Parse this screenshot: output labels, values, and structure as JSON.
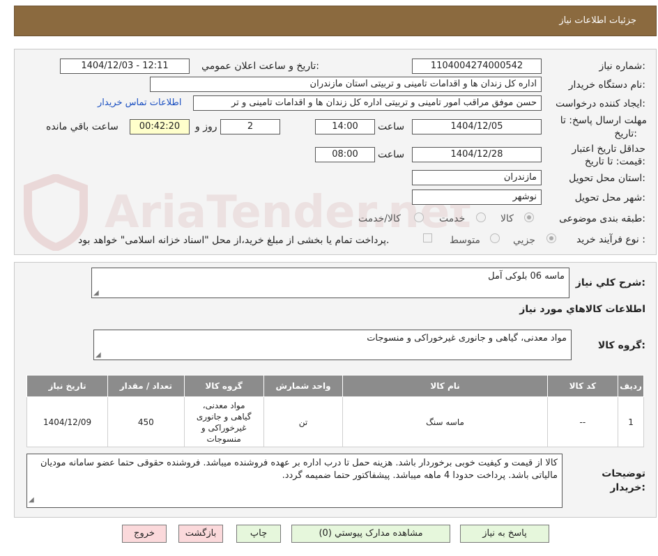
{
  "header": {
    "title": "جزئیات اطلاعات نیاز"
  },
  "watermark": "AriaTender.net",
  "form": {
    "need_number_label": "شماره نیاز:",
    "need_number": "1104004274000542",
    "announce_label": "تاریخ و ساعت اعلان عمومي:",
    "announce_value": "1404/12/03 - 12:11",
    "buyer_org_label": "نام دستگاه خريدار:",
    "buyer_org": "اداره کل زندان ها و اقدامات تامینی و تربیتی استان مازندران",
    "creator_label": "ايجاد کننده درخواست:",
    "creator": "حسن موفق مراقب امور تامینی و تربیتی اداره کل زندان ها و اقدامات تامینی و تر",
    "contact_link": "اطلاعات تماس خریدار",
    "deadline_label_1": "مهلت ارسال پاسخ: تا",
    "deadline_label_2": "تاریخ:",
    "deadline_date": "1404/12/05",
    "time_word": "ساعت",
    "deadline_time": "14:00",
    "days_value": "2",
    "days_word": "روز و",
    "remaining_time": "00:42:20",
    "remaining_word": "ساعت باقي مانده",
    "validity_label_1": "حداقل تاريخ اعتبار",
    "validity_label_2": "قيمت: تا تاريخ:",
    "validity_date": "1404/12/28",
    "validity_time": "08:00",
    "province_label": "استان محل تحويل:",
    "province": "مازندران",
    "city_label": "شهر محل تحويل:",
    "city": "نوشهر",
    "category_label": "طبقه بندی موضوعی:",
    "category_options": [
      "کالا",
      "خدمت",
      "کالا/خدمت"
    ],
    "process_label": "نوع فرآيند خريد :",
    "process_options": [
      "جزيي",
      "متوسط"
    ],
    "process_note": "پرداخت تمام یا بخشی از مبلغ خرید،از محل \"اسناد خزانه اسلامی\" خواهد بود."
  },
  "summary": {
    "general_desc_label": "شرح کلي نياز:",
    "general_desc": "ماسه 06 بلوکی آمل",
    "goods_info_title": "اطلاعات کالاهاي مورد نياز",
    "goods_group_label": "گروه کالا:",
    "goods_group": "مواد معدنی، گیاهی و جانوری غیرخوراکی و منسوجات"
  },
  "table": {
    "headers": [
      "رديف",
      "کد کالا",
      "نام کالا",
      "واحد شمارش",
      "گروه کالا",
      "تعداد / مقدار",
      "تاريخ نياز"
    ],
    "rows": [
      {
        "row": "1",
        "code": "--",
        "name": "ماسه سنگ",
        "unit": "تن",
        "group": "مواد معدنی، گیاهی و جانوری غیرخوراکی و منسوجات",
        "qty": "450",
        "date": "1404/12/09"
      }
    ]
  },
  "buyer_notes": {
    "label_1": "توضيحات",
    "label_2": "خريدار:",
    "text": "کالا از قیمت و کیفیت خوبی برخوردار باشد. هزینه حمل تا درب اداره بر عهده فروشنده میباشد. فروشنده حقوقی حتما عضو سامانه مودیان مالیاتی باشد. پرداخت حدودا 4 ماهه میباشد. پیشفاکتور حتما ضمیمه گردد."
  },
  "buttons": {
    "reply": "پاسخ به نياز",
    "attachments": "مشاهده مدارک پيوستي (0)",
    "print": "چاپ",
    "back": "بازگشت",
    "exit": "خروج"
  }
}
